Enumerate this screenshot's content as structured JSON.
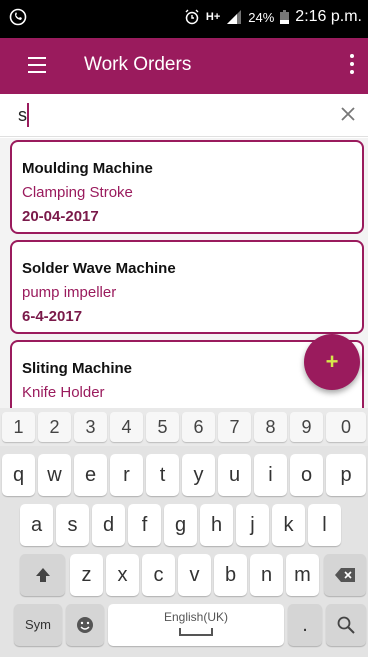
{
  "status_bar": {
    "battery_percent": "24%",
    "time": "2:16 p.m.",
    "network": "H+"
  },
  "app_bar": {
    "title": "Work Orders"
  },
  "search": {
    "value": "s"
  },
  "work_orders": [
    {
      "machine": "Moulding Machine",
      "part": "Clamping Stroke",
      "date": "20-04-2017"
    },
    {
      "machine": "Solder Wave Machine",
      "part": "pump impeller",
      "date": "6-4-2017"
    },
    {
      "machine": "Sliting Machine",
      "part": "Knife Holder",
      "date": ""
    }
  ],
  "fab": {
    "label": "+"
  },
  "keyboard": {
    "numbers": [
      "1",
      "2",
      "3",
      "4",
      "5",
      "6",
      "7",
      "8",
      "9",
      "0"
    ],
    "row1": [
      "q",
      "w",
      "e",
      "r",
      "t",
      "y",
      "u",
      "i",
      "o",
      "p"
    ],
    "row2": [
      "a",
      "s",
      "d",
      "f",
      "g",
      "h",
      "j",
      "k",
      "l"
    ],
    "row3": [
      "z",
      "x",
      "c",
      "v",
      "b",
      "n",
      "m"
    ],
    "sym_label": "Sym",
    "space_label": "English(UK)",
    "period_label": ".",
    "colors": {
      "accent": "#9a1b5d"
    }
  }
}
